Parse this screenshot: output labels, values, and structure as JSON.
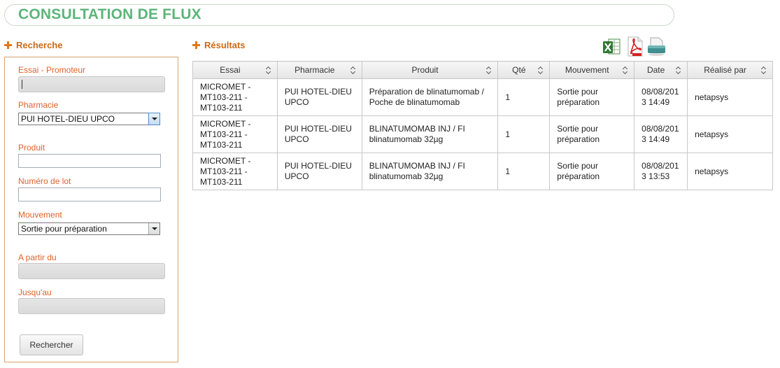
{
  "page": {
    "title": "CONSULTATION DE FLUX"
  },
  "search": {
    "heading": "Recherche",
    "essai_label": "Essai - Promoteur",
    "pharmacie_label": "Pharmacie",
    "pharmacie_value": "PUI HOTEL-DIEU UPCO",
    "produit_label": "Produit",
    "lot_label": "Numéro de lot",
    "mouvement_label": "Mouvement",
    "mouvement_value": "Sortie pour préparation",
    "from_label": "A partir du",
    "to_label": "Jusqu'au",
    "submit_label": "Rechercher"
  },
  "results": {
    "heading": "Résultats",
    "export_icons": [
      "excel-icon",
      "pdf-icon",
      "csv-icon"
    ],
    "columns": [
      "Essai",
      "Pharmacie",
      "Produit",
      "Qté",
      "Mouvement",
      "Date",
      "Réalisé par"
    ],
    "rows": [
      {
        "essai": [
          "MICROMET -",
          "MT103-211 -",
          "MT103-211"
        ],
        "pharmacie": [
          "PUI HOTEL-DIEU",
          "UPCO"
        ],
        "produit": [
          "Préparation de blinatumomab /",
          "Poche de blinatumomab"
        ],
        "qte": "1",
        "mouvement": [
          "Sortie pour",
          "préparation"
        ],
        "date": [
          "08/08/201",
          "3 14:49"
        ],
        "user": "netapsys"
      },
      {
        "essai": [
          "MICROMET -",
          "MT103-211 -",
          "MT103-211"
        ],
        "pharmacie": [
          "PUI HOTEL-DIEU",
          "UPCO"
        ],
        "produit": [
          "BLINATUMOMAB INJ / FI",
          "blinatumomab 32µg"
        ],
        "qte": "1",
        "mouvement": [
          "Sortie pour",
          "préparation"
        ],
        "date": [
          "08/08/201",
          "3 14:49"
        ],
        "user": "netapsys"
      },
      {
        "essai": [
          "MICROMET -",
          "MT103-211 -",
          "MT103-211"
        ],
        "pharmacie": [
          "PUI HOTEL-DIEU",
          "UPCO"
        ],
        "produit": [
          "BLINATUMOMAB INJ / FI",
          "blinatumomab 32µg"
        ],
        "qte": "1",
        "mouvement": [
          "Sortie pour",
          "préparation"
        ],
        "date": [
          "08/08/201",
          "3 13:53"
        ],
        "user": "netapsys"
      }
    ]
  },
  "colors": {
    "accent": "#e07818",
    "title": "#5cb57a",
    "label": "#e0622a",
    "panel_border": "#d9a36b"
  }
}
